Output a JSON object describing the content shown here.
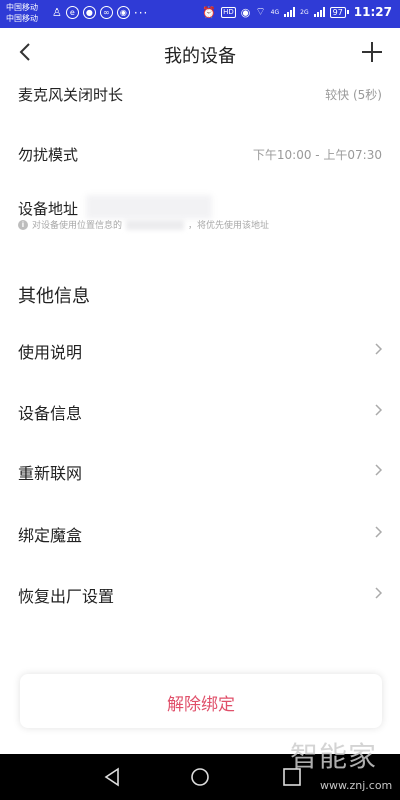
{
  "status_bar": {
    "carrier_1": "中国移动",
    "carrier_2": "中国移动",
    "network_1": "4G",
    "network_2": "2G",
    "hd_badge": "HD",
    "battery": "97",
    "time": "11:27",
    "dots": "···"
  },
  "header": {
    "title": "我的设备",
    "back_icon": "chevron-left-icon",
    "add_icon": "plus-icon"
  },
  "settings": {
    "mic_off": {
      "label": "麦克风关闭时长",
      "value": "较快 (5秒)"
    },
    "dnd": {
      "label": "勿扰模式",
      "value": "下午10:00 - 上午07:30"
    },
    "address": {
      "label": "设备地址",
      "hint_prefix": "对设备使用位置信息的",
      "hint_suffix": "，将优先使用该地址"
    }
  },
  "other_info": {
    "title": "其他信息",
    "items": [
      {
        "label": "使用说明"
      },
      {
        "label": "设备信息"
      },
      {
        "label": "重新联网"
      },
      {
        "label": "绑定魔盒"
      },
      {
        "label": "恢复出厂设置"
      }
    ]
  },
  "actions": {
    "unbind_label": "解除绑定"
  },
  "watermark": {
    "main": "智能家",
    "sub": "www.znj.com"
  },
  "colors": {
    "status_bar": "#2f3bd6",
    "danger": "#e0506a",
    "secondary_text": "#9a9a9a"
  }
}
